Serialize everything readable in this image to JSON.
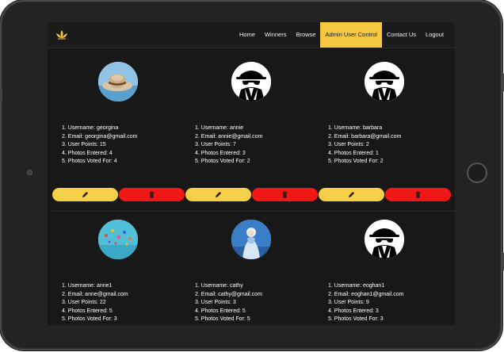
{
  "nav": {
    "items": [
      {
        "label": "Home",
        "active": false
      },
      {
        "label": "Winners",
        "active": false
      },
      {
        "label": "Browse",
        "active": false
      },
      {
        "label": "Admin User Control",
        "active": true
      },
      {
        "label": "Contact Us",
        "active": false
      },
      {
        "label": "Logout",
        "active": false
      }
    ],
    "logo_icon": "lotus-logo-icon",
    "accent_color": "#f5c842"
  },
  "users": [
    {
      "avatar": "hat-photo",
      "username": "1. Username: georgina",
      "email": "2. Email: georgina@gmail.com",
      "points": "3. User Points: 15",
      "entered": "4. Photos Entered: 4",
      "voted": "5. Photos Voted For: 4"
    },
    {
      "avatar": "spy-icon",
      "username": "1. Username: annie",
      "email": "2. Email: annie@gmail.com",
      "points": "3. User Points: 7",
      "entered": "4. Photos Entered: 3",
      "voted": "5. Photos Voted For: 2"
    },
    {
      "avatar": "spy-icon",
      "username": "1. Username: barbara",
      "email": "2. Email: barbara@gmail.com",
      "points": "3. User Points: 2",
      "entered": "4. Photos Entered: 1",
      "voted": "5. Photos Voted For: 2"
    },
    {
      "avatar": "balloons-photo",
      "username": "1. Username: anne1",
      "email": "2. Email: anne@gmail.com",
      "points": "3. User Points: 22",
      "entered": "4. Photos Entered: 5",
      "voted": "5. Photos Voted For: 3"
    },
    {
      "avatar": "winter-photo",
      "username": "1. Username: cathy",
      "email": "2. Email: cathy@gmail.com",
      "points": "3. User Points: 3",
      "entered": "4. Photos Entered: 5",
      "voted": "5. Photos Voted For: 5"
    },
    {
      "avatar": "spy-icon",
      "username": "1. Username: eoghan1",
      "email": "2. Email: eoghan1@gmail.com",
      "points": "3. User Points: 9",
      "entered": "4. Photos Entered: 3",
      "voted": "5. Photos Voted For: 3"
    }
  ],
  "buttons": {
    "edit_icon": "pencil-icon",
    "delete_icon": "trash-icon",
    "edit_color": "#f5cf4a",
    "delete_color": "#f01717"
  }
}
